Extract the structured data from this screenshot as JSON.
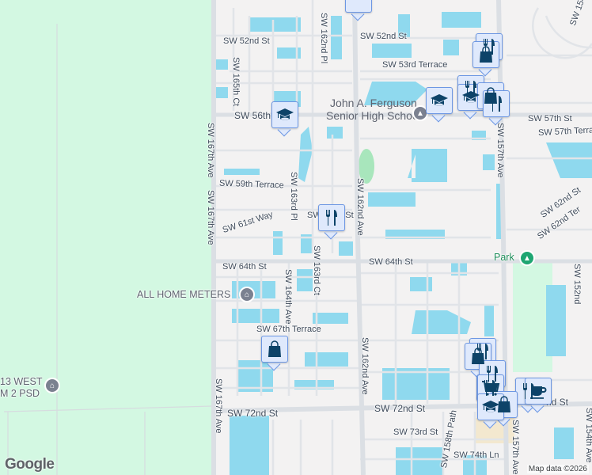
{
  "streets": [
    "SW 52nd St",
    "SW 52nd St",
    "SW 53rd Terrace",
    "SW 165th Ct",
    "SW 162nd Pl",
    "SW 56th",
    "SW 57th St",
    "SW 57th Terrace",
    "SW 157th Ave",
    "SW 167th Ave",
    "SW 167th Ave",
    "SW 59th Terrace",
    "SW 163rd Pl",
    "SW 61st Way",
    "SW 162nd Ave",
    "SW 62nd St",
    "SW 62nd Ter",
    "SW 154",
    "SW 64th St",
    "SW 64th St",
    "SW 163rd Ct",
    "SW 164th Ave",
    "SW 67th Terrace",
    "SW 162nd Ave",
    "SW 167th Ave",
    "SW 72nd St",
    "SW 72nd St",
    "SW 73rd St",
    "SW 158th Path",
    "SW 74th Ln",
    "SW 157th Ave",
    "SW 152nd",
    "SW 154th Ave",
    "SW 62nd St",
    "nd St"
  ],
  "places": {
    "school_line1": "John A. Ferguson",
    "school_line2": "Senior High School",
    "park": "Park",
    "meters": "ALL HOME METERS",
    "west_line1": "13 WEST",
    "west_line2": "M 2 PSD"
  },
  "markers": [
    {
      "type": "school",
      "icon": "graduation-cap-icon"
    },
    {
      "type": "school",
      "icon": "graduation-cap-icon"
    },
    {
      "type": "restaurant",
      "icon": "fork-knife-icon"
    },
    {
      "type": "shopping",
      "icon": "shopping-bag-icon"
    },
    {
      "type": "restaurant",
      "icon": "fork-knife-icon"
    },
    {
      "type": "shopping",
      "icon": "shopping-bag-icon"
    },
    {
      "type": "restaurant",
      "icon": "fork-knife-icon"
    },
    {
      "type": "school",
      "icon": "graduation-cap-icon"
    },
    {
      "type": "shopping",
      "icon": "shopping-bag-icon"
    },
    {
      "type": "restaurant",
      "icon": "fork-knife-icon"
    },
    {
      "type": "restaurant",
      "icon": "fork-knife-icon"
    },
    {
      "type": "shopping",
      "icon": "shopping-bag-icon"
    },
    {
      "type": "restaurant",
      "icon": "fork-knife-icon"
    },
    {
      "type": "restaurant",
      "icon": "fork-knife-icon"
    },
    {
      "type": "grocery",
      "icon": "shopping-cart-icon"
    },
    {
      "type": "restaurant",
      "icon": "fork-knife-icon"
    },
    {
      "type": "cafe",
      "icon": "coffee-cup-icon"
    },
    {
      "type": "shopping",
      "icon": "shopping-bag-icon"
    },
    {
      "type": "school",
      "icon": "graduation-cap-icon"
    }
  ],
  "footer": {
    "logo": "Google",
    "attribution": "Map data ©2026"
  },
  "colors": {
    "land": "#f3f2f2",
    "green": "#d3f8e2",
    "water": "#8fd9ee",
    "road": "#dde1e6",
    "marker_bg": "#dfe9fc",
    "marker_border": "#6d97e3",
    "icon": "#0d4368"
  }
}
